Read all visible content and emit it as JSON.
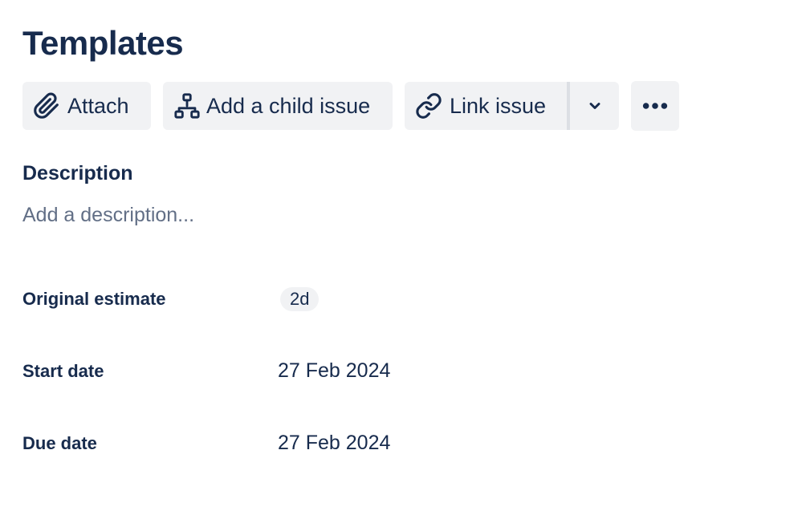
{
  "page": {
    "title": "Templates"
  },
  "toolbar": {
    "attach_label": "Attach",
    "add_child_label": "Add a child issue",
    "link_issue_label": "Link issue",
    "icons": {
      "attach": "paperclip-icon",
      "add_child": "hierarchy-icon",
      "link_issue": "link-icon",
      "dropdown": "chevron-down-icon",
      "more": "more-horizontal-icon"
    }
  },
  "description": {
    "heading": "Description",
    "placeholder": "Add a description..."
  },
  "fields": {
    "original_estimate": {
      "label": "Original estimate",
      "value": "2d"
    },
    "start_date": {
      "label": "Start date",
      "value": "27 Feb 2024"
    },
    "due_date": {
      "label": "Due date",
      "value": "27 Feb 2024"
    }
  },
  "colors": {
    "text_primary": "#172b4d",
    "text_subtle": "#626f86",
    "button_bg": "#f1f2f4",
    "divider": "#dcdfe4"
  }
}
